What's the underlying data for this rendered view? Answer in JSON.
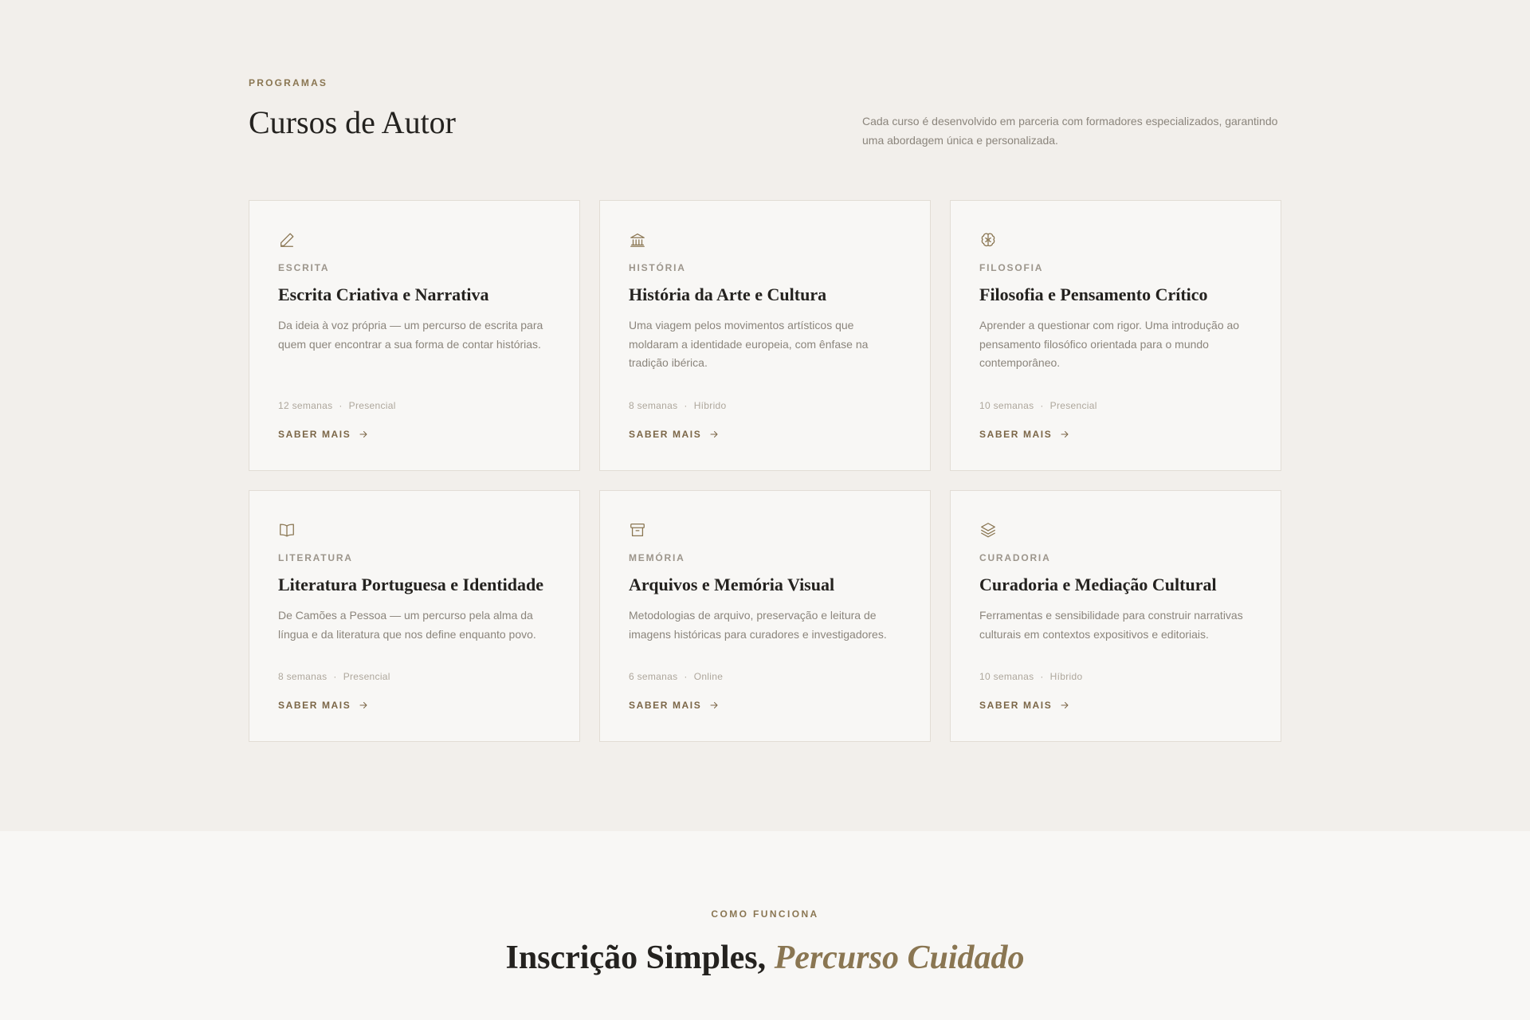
{
  "programs": {
    "eyebrow": "PROGRAMAS",
    "title": "Cursos de Autor",
    "intro": "Cada curso é desenvolvido em parceria com formadores especializados, garantindo uma abordagem única e personalizada."
  },
  "cards": [
    {
      "icon": "pen-icon",
      "category": "ESCRITA",
      "title": "Escrita Criativa e Narrativa",
      "description": "Da ideia à voz própria — um percurso de escrita para quem quer encontrar a sua forma de contar histórias.",
      "duration": "12 semanas",
      "format": "Presencial",
      "link": "SABER MAIS"
    },
    {
      "icon": "museum-icon",
      "category": "HISTÓRIA",
      "title": "História da Arte e Cultura",
      "description": "Uma viagem pelos movimentos artísticos que moldaram a identidade europeia, com ênfase na tradição ibérica.",
      "duration": "8 semanas",
      "format": "Híbrido",
      "link": "SABER MAIS"
    },
    {
      "icon": "brain-icon",
      "category": "FILOSOFIA",
      "title": "Filosofia e Pensamento Crítico",
      "description": "Aprender a questionar com rigor. Uma introdução ao pensamento filosófico orientada para o mundo contemporâneo.",
      "duration": "10 semanas",
      "format": "Presencial",
      "link": "SABER MAIS"
    },
    {
      "icon": "open-book-icon",
      "category": "LITERATURA",
      "title": "Literatura Portuguesa e Identidade",
      "description": "De Camões a Pessoa — um percurso pela alma da língua e da literatura que nos define enquanto povo.",
      "duration": "8 semanas",
      "format": "Presencial",
      "link": "SABER MAIS"
    },
    {
      "icon": "archive-box-icon",
      "category": "MEMÓRIA",
      "title": "Arquivos e Memória Visual",
      "description": "Metodologias de arquivo, preservação e leitura de imagens históricas para curadores e investigadores.",
      "duration": "6 semanas",
      "format": "Online",
      "link": "SABER MAIS"
    },
    {
      "icon": "layers-icon",
      "category": "CURADORIA",
      "title": "Curadoria e Mediação Cultural",
      "description": "Ferramentas e sensibilidade para construir narrativas culturais em contextos expositivos e editoriais.",
      "duration": "10 semanas",
      "format": "Híbrido",
      "link": "SABER MAIS"
    }
  ],
  "meta_separator": "·",
  "process": {
    "eyebrow": "COMO FUNCIONA",
    "title_main": "Inscrição Simples,",
    "title_accent": "Percurso Cuidado"
  },
  "colors": {
    "background_programs": "#f2efeb",
    "background_process": "#f8f7f5",
    "card_background": "#f8f7f5",
    "card_border": "#e2ddd5",
    "accent": "#8a7652",
    "heading": "#24221f",
    "body_text": "#8b857c"
  }
}
